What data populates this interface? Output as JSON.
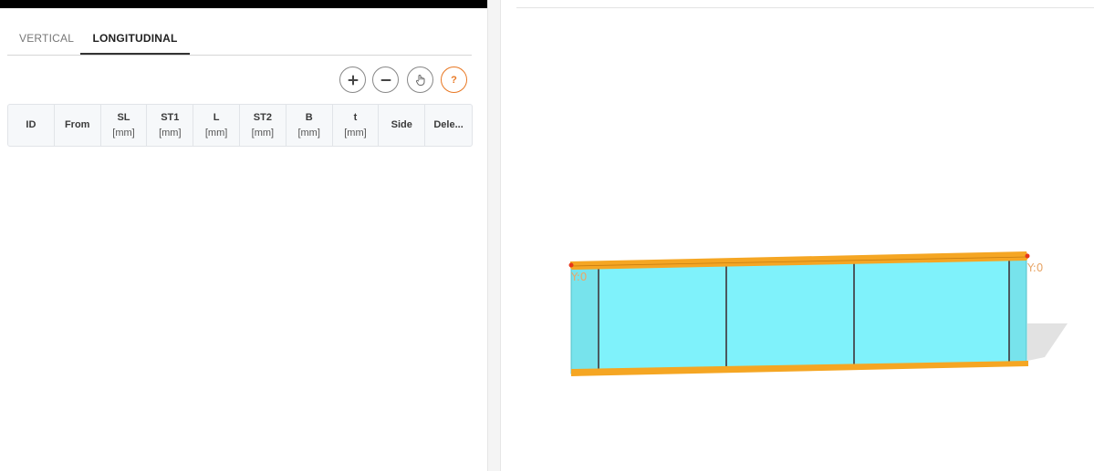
{
  "tabs": [
    {
      "label": "VERTICAL",
      "active": false
    },
    {
      "label": "LONGITUDINAL",
      "active": true
    }
  ],
  "toolbar": {
    "add_icon": "plus-icon",
    "remove_icon": "minus-icon",
    "pick_icon": "hand-pointer-icon",
    "help_label": "?"
  },
  "grid": {
    "columns": [
      {
        "label": "ID",
        "unit": ""
      },
      {
        "label": "From",
        "unit": ""
      },
      {
        "label": "SL",
        "unit": "[mm]"
      },
      {
        "label": "ST1",
        "unit": "[mm]"
      },
      {
        "label": "L",
        "unit": "[mm]"
      },
      {
        "label": "ST2",
        "unit": "[mm]"
      },
      {
        "label": "B",
        "unit": "[mm]"
      },
      {
        "label": "t",
        "unit": "[mm]"
      },
      {
        "label": "Side",
        "unit": ""
      },
      {
        "label": "Dele...",
        "unit": ""
      }
    ]
  },
  "viewport": {
    "label_left": "Y:0",
    "label_right": "Y:0",
    "colors": {
      "flange": "#f5a623",
      "web": "#7ff2fb",
      "stiffener": "#4a5a60",
      "marker": "#e8361a"
    }
  }
}
